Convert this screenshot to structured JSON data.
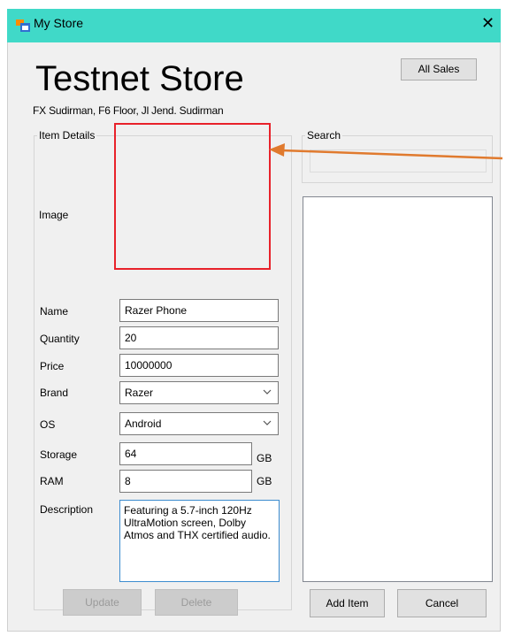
{
  "window": {
    "title": "My Store",
    "close_glyph": "✕"
  },
  "header": {
    "store_name": "Testnet Store",
    "address": "FX Sudirman, F6 Floor, Jl Jend. Sudirman",
    "all_sales_label": "All Sales"
  },
  "item_details": {
    "group_label": "Item Details",
    "image_label": "Image",
    "fields": {
      "name_label": "Name",
      "name_value": "Razer Phone",
      "quantity_label": "Quantity",
      "quantity_value": "20",
      "price_label": "Price",
      "price_value": "10000000",
      "brand_label": "Brand",
      "brand_value": "Razer",
      "os_label": "OS",
      "os_value": "Android",
      "storage_label": "Storage",
      "storage_value": "64",
      "storage_unit": "GB",
      "ram_label": "RAM",
      "ram_value": "8",
      "ram_unit": "GB",
      "description_label": "Description",
      "description_value": "Featuring a 5.7-inch 120Hz UltraMotion screen, Dolby Atmos and THX certified audio."
    },
    "update_label": "Update",
    "delete_label": "Delete"
  },
  "search": {
    "group_label": "Search",
    "value": ""
  },
  "actions": {
    "add_item_label": "Add Item",
    "cancel_label": "Cancel"
  },
  "icons": {
    "dropdown": "chevron-down-icon",
    "app": "app-window-icon",
    "annotation_arrow": "arrow-left-icon"
  },
  "colors": {
    "titlebar": "#40d9c8",
    "highlight_box": "#e8212a",
    "annotation_arrow": "#e07a2e",
    "focus_border": "#3c8ccf"
  }
}
